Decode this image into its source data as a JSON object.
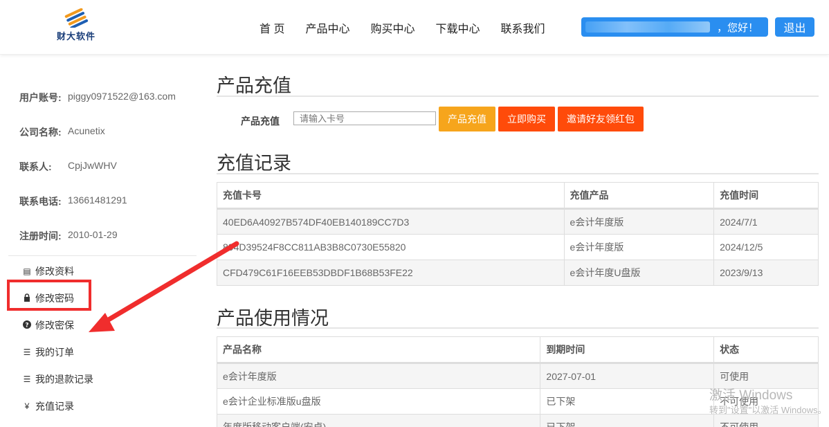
{
  "brand": {
    "logo_text": "财大软件"
  },
  "nav": {
    "items": [
      {
        "label": "首 页"
      },
      {
        "label": "产品中心"
      },
      {
        "label": "购买中心"
      },
      {
        "label": "下载中心"
      },
      {
        "label": "联系我们"
      }
    ]
  },
  "header": {
    "greeting": "，您好！",
    "logout_label": "退出"
  },
  "profile": {
    "account_label": "用户账号:",
    "account_value": "piggy0971522@163.com",
    "company_label": "公司名称:",
    "company_value": "Acunetix",
    "contact_label": "联系人:",
    "contact_value": "CpjJwWHV",
    "phone_label": "联系电话:",
    "phone_value": "13661481291",
    "reg_label": "注册时间:",
    "reg_value": "2010-01-29"
  },
  "menu": {
    "items": [
      {
        "label": "修改资料",
        "icon": "profile-card-icon"
      },
      {
        "label": "修改密码",
        "icon": "lock-icon"
      },
      {
        "label": "修改密保",
        "icon": "question-circle-icon"
      },
      {
        "label": "我的订单",
        "icon": "list-icon"
      },
      {
        "label": "我的退款记录",
        "icon": "list-icon"
      },
      {
        "label": "充值记录",
        "icon": "yen-icon"
      }
    ]
  },
  "recharge": {
    "section_title": "产品充值",
    "field_label": "产品充值",
    "card_placeholder": "请输入卡号",
    "recharge_button": "产品充值",
    "buy_button": "立即购买",
    "invite_button": "邀请好友领红包"
  },
  "records": {
    "section_title": "充值记录",
    "headers": [
      "充值卡号",
      "充值产品",
      "充值时间"
    ],
    "rows": [
      [
        "40ED6A40927B574DF40EB140189CC7D3",
        "e会计年度版",
        "2024/7/1"
      ],
      [
        "894D39524F8CC811AB3B8C0730E55820",
        "e会计年度版",
        "2024/12/5"
      ],
      [
        "CFD479C61F16EEB53DBDF1B68B53FE22",
        "e会计年度U盘版",
        "2023/9/13"
      ]
    ]
  },
  "usage": {
    "section_title": "产品使用情况",
    "headers": [
      "产品名称",
      "到期时间",
      "状态"
    ],
    "rows": [
      [
        "e会计年度版",
        "2027-07-01",
        "可使用"
      ],
      [
        "e会计企业标准版u盘版",
        "已下架",
        "不可使用"
      ],
      [
        "年度版移动客户端(安卓)",
        "已下架",
        "不可使用"
      ]
    ]
  },
  "watermark": {
    "line1": "激活 Windows",
    "line2": "转到\"设置\"以激活 Windows。"
  },
  "colors": {
    "accent_blue": "#2a8ef0",
    "orange_button": "#f6a51c",
    "red_button": "#ff4b0a",
    "annotation_red": "#f02d2d"
  }
}
